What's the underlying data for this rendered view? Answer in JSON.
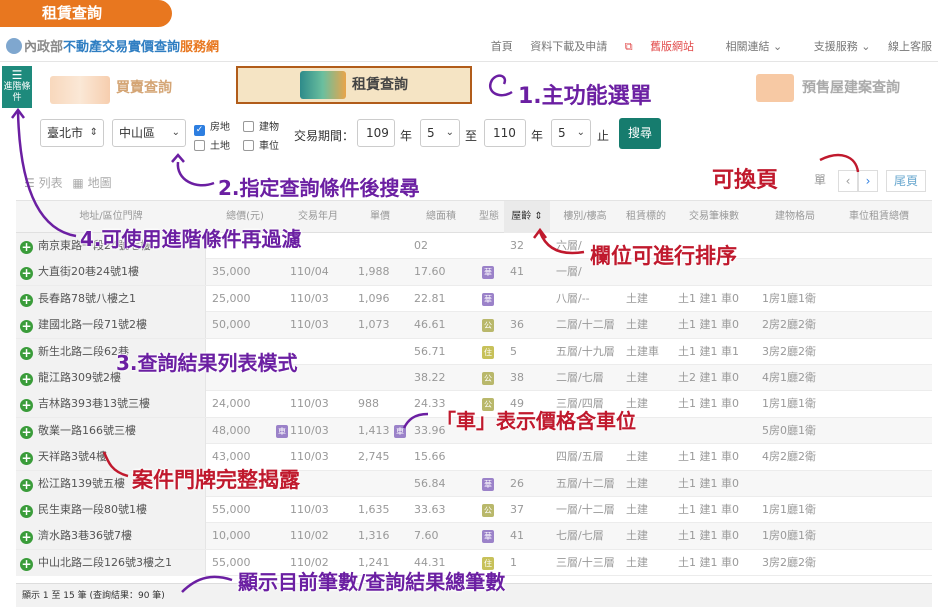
{
  "banner": {
    "label": "租賃查詢"
  },
  "site": {
    "logo_main": "內政部",
    "logo_sub": "不動產交易實價查詢",
    "logo_accent": "服務網"
  },
  "topnav": [
    "首頁",
    "資料下載及申請",
    "舊版網站",
    "相關連結",
    "支援服務",
    "線上客服"
  ],
  "function_tabs": {
    "advanced": "進階條件",
    "buy": "買賣查詢",
    "rent": "租賃查詢",
    "presale": "預售屋建案查詢"
  },
  "search": {
    "city": "臺北市",
    "district": "中山區",
    "types": [
      {
        "label": "房地",
        "checked": true
      },
      {
        "label": "建物",
        "checked": false
      },
      {
        "label": "土地",
        "checked": false
      },
      {
        "label": "車位",
        "checked": false
      }
    ],
    "period_label": "交易期間：",
    "from_year": "109",
    "year_unit": "年",
    "from_month": "5",
    "to_label": "至",
    "to_year": "110",
    "to_month": "5",
    "end_label": "止",
    "button": "搜尋"
  },
  "view_tabs": {
    "list": "列表",
    "map": "地圖"
  },
  "pager": {
    "last_tab": "單",
    "prev": "‹",
    "next": "›",
    "last": "尾頁"
  },
  "table": {
    "headers": [
      "地址/區位門牌",
      "總價(元)",
      "交易年月",
      "單價",
      "總面積",
      "型態",
      "屋齡",
      "樓別/樓高",
      "租賃標的",
      "交易筆棟數",
      "建物格局",
      "車位租賃總價"
    ],
    "rows": [
      {
        "addr": "南京東路一段24號七樓",
        "price": "",
        "date": "",
        "unit": "",
        "area": "02",
        "type": "",
        "age": "32",
        "floor": "六層/",
        "target": "",
        "count": "",
        "layout": ""
      },
      {
        "addr": "大直街20巷24號1樓",
        "price": "35,000",
        "date": "110/04",
        "unit": "1,988",
        "area": "17.60",
        "type": "華",
        "age": "41",
        "floor": "一層/",
        "target": "",
        "count": "",
        "layout": ""
      },
      {
        "addr": "長春路78號八樓之1",
        "price": "25,000",
        "date": "110/03",
        "unit": "1,096",
        "area": "22.81",
        "type": "華",
        "age": "",
        "floor": "八層/--",
        "target": "土建",
        "count": "土1 建1 車0",
        "layout": "1房1廳1衛"
      },
      {
        "addr": "建國北路一段71號2樓",
        "price": "50,000",
        "date": "110/03",
        "unit": "1,073",
        "area": "46.61",
        "type": "公",
        "age": "36",
        "floor": "二層/十二層",
        "target": "土建",
        "count": "土1 建1 車0",
        "layout": "2房2廳2衛"
      },
      {
        "addr": "新生北路二段62巷",
        "price": "",
        "date": "",
        "unit": "",
        "area": "56.71",
        "type": "住",
        "age": "5",
        "floor": "五層/十九層",
        "target": "土建車",
        "count": "土1 建1 車1",
        "layout": "3房2廳2衛"
      },
      {
        "addr": "龍江路309號2樓",
        "price": "",
        "date": "",
        "unit": "",
        "area": "38.22",
        "type": "公",
        "age": "38",
        "floor": "二層/七層",
        "target": "土建",
        "count": "土2 建1 車0",
        "layout": "4房1廳2衛"
      },
      {
        "addr": "吉林路393巷13號三樓",
        "price": "24,000",
        "date": "110/03",
        "unit": "988",
        "area": "24.33",
        "type": "公",
        "age": "49",
        "floor": "三層/四層",
        "target": "土建",
        "count": "土1 建1 車0",
        "layout": "1房1廳1衛"
      },
      {
        "addr": "敬業一路166號三樓",
        "price": "48,000",
        "date": "110/03",
        "unit": "1,413",
        "area": "33.96",
        "type": "",
        "age": "",
        "floor": "",
        "target": "",
        "count": "",
        "layout": "5房0廳1衛"
      },
      {
        "addr": "天祥路3號4樓",
        "price": "43,000",
        "date": "110/03",
        "unit": "2,745",
        "area": "15.66",
        "type": "",
        "age": "",
        "floor": "四層/五層",
        "target": "土建",
        "count": "土1 建1 車0",
        "layout": "4房2廳2衛"
      },
      {
        "addr": "松江路139號五樓",
        "price": "",
        "date": "",
        "unit": "",
        "area": "56.84",
        "type": "華",
        "age": "26",
        "floor": "五層/十二層",
        "target": "土建",
        "count": "土1 建1 車0",
        "layout": ""
      },
      {
        "addr": "民生東路一段80號1樓",
        "price": "55,000",
        "date": "110/03",
        "unit": "1,635",
        "area": "33.63",
        "type": "公",
        "age": "37",
        "floor": "一層/十二層",
        "target": "土建",
        "count": "土1 建1 車0",
        "layout": "1房1廳1衛"
      },
      {
        "addr": "濟水路3巷36號7樓",
        "price": "10,000",
        "date": "110/02",
        "unit": "1,316",
        "area": "7.60",
        "type": "華",
        "age": "41",
        "floor": "七層/七層",
        "target": "土建",
        "count": "土1 建1 車0",
        "layout": "1房0廳1衛"
      },
      {
        "addr": "中山北路二段126號3樓之1",
        "price": "55,000",
        "date": "110/02",
        "unit": "1,241",
        "area": "44.31",
        "type": "住",
        "age": "1",
        "floor": "三層/十三層",
        "target": "土建",
        "count": "土1 建1 車0",
        "layout": "3房2廳2衛"
      }
    ],
    "car_badge": "車"
  },
  "footer": "顯示 1 至 15 筆 (查詢結果：90 筆)",
  "annotations": {
    "a1": "1.主功能選單",
    "a2": "2.指定查詢條件後搜尋",
    "a3": "3.查詢結果列表模式",
    "a4": "4.可使用進階條件再過濾",
    "pages": "可換頁",
    "sort": "欄位可進行排序",
    "car": "「車」表示價格含車位",
    "addr": "案件門牌完整揭露",
    "count": "顯示目前筆數/查詢結果總筆數"
  }
}
